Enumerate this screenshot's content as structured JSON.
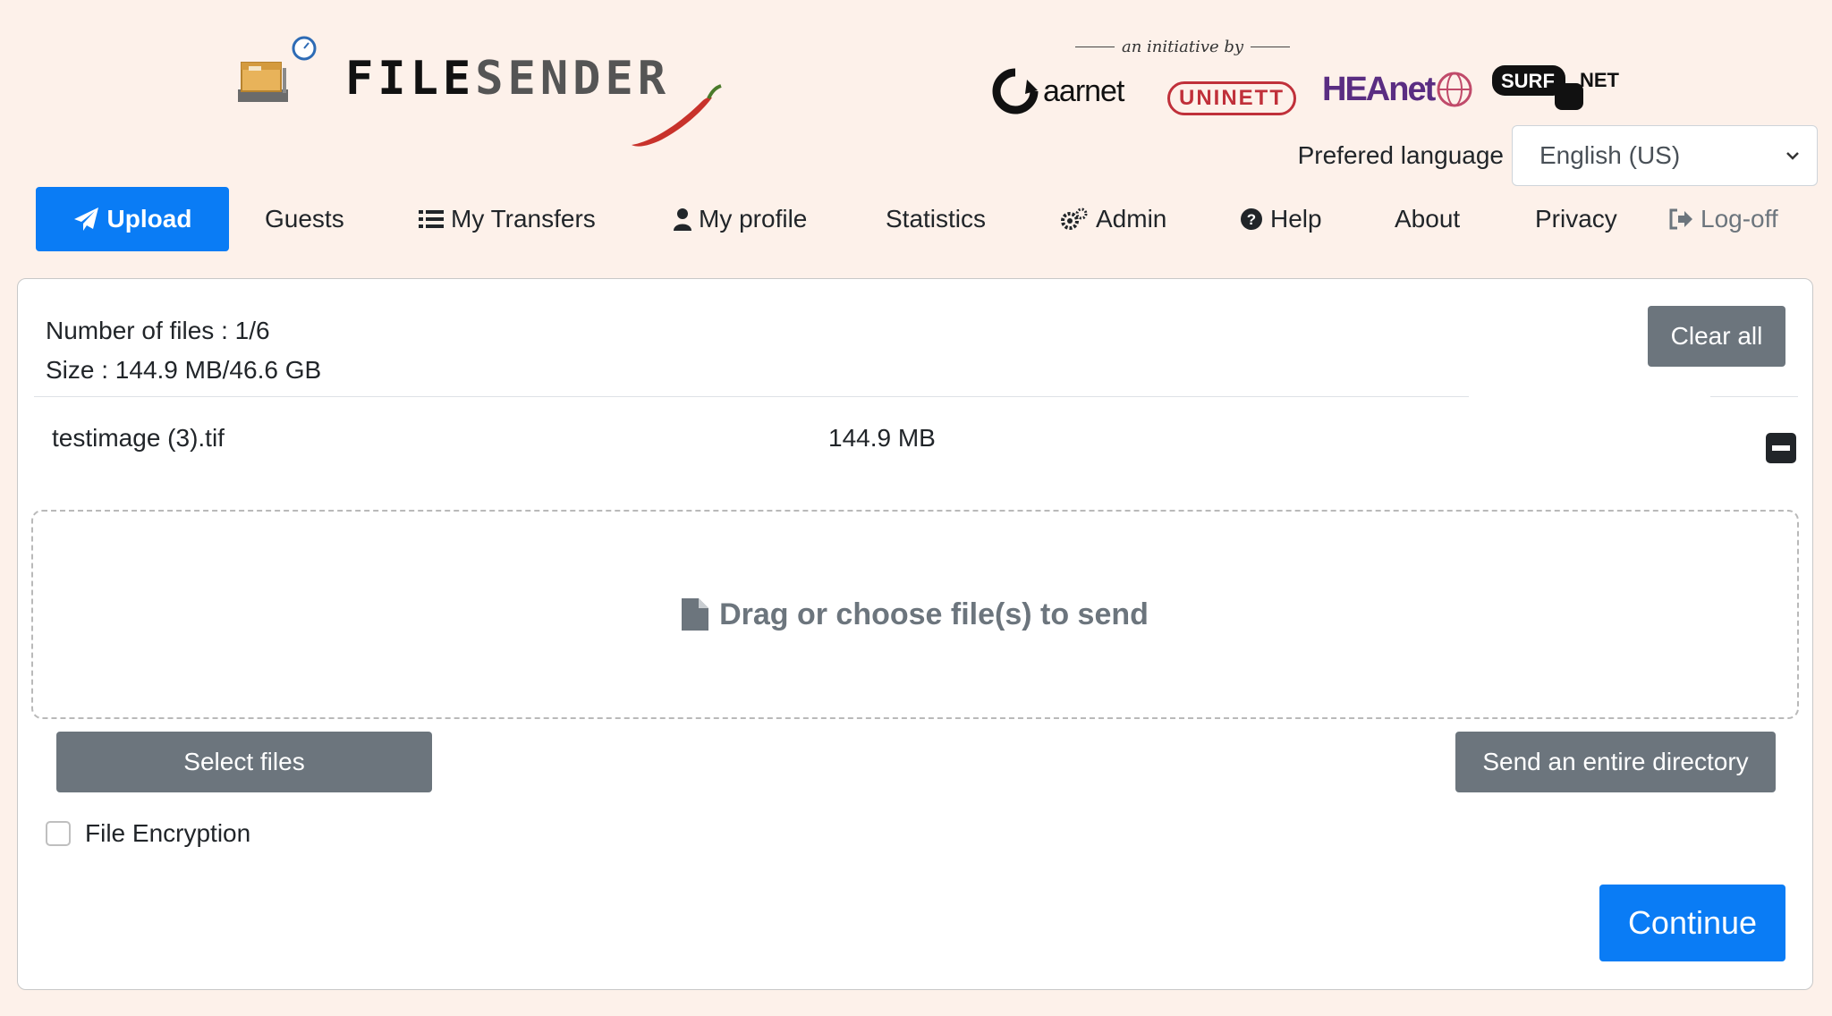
{
  "header": {
    "logo_text_primary": "FILE",
    "logo_text_secondary": "SENDER",
    "initiative_text": "an initiative by",
    "partners": {
      "aarnet": "aarnet",
      "uninett": "UNINETT",
      "heanet": "HEAnet",
      "surf_left": "SURF",
      "surf_right": "NET"
    }
  },
  "language": {
    "label": "Prefered language",
    "selected": "English (US)"
  },
  "nav": {
    "items": [
      {
        "label": "Upload",
        "icon": "paper-plane-icon",
        "active": true
      },
      {
        "label": "Guests"
      },
      {
        "label": "My Transfers",
        "icon": "list-icon"
      },
      {
        "label": "My profile",
        "icon": "user-icon"
      },
      {
        "label": "Statistics"
      },
      {
        "label": "Admin",
        "icon": "gears-icon"
      },
      {
        "label": "Help",
        "icon": "question-circle-icon"
      },
      {
        "label": "About"
      },
      {
        "label": "Privacy"
      },
      {
        "label": "Log-off",
        "icon": "sign-out-icon"
      }
    ]
  },
  "upload": {
    "number_of_files": "Number of files : 1/6",
    "size": "Size : 144.9 MB/46.6 GB",
    "clear_all_label": "Clear all",
    "files": [
      {
        "name": "testimage (3).tif",
        "size": "144.9 MB"
      }
    ],
    "dropzone_text": "Drag or choose file(s) to send",
    "select_files_label": "Select files",
    "send_directory_label": "Send an entire directory",
    "encryption_label": "File Encryption",
    "encryption_checked": false,
    "continue_label": "Continue"
  },
  "colors": {
    "background": "#fdf1ea",
    "primary": "#0a7cf5",
    "secondary": "#6c757d"
  }
}
